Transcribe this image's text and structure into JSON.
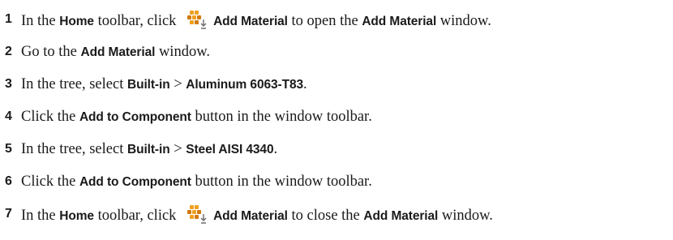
{
  "steps": [
    {
      "number": "1",
      "parts": [
        {
          "t": "In the "
        },
        {
          "t": "Home",
          "b": true
        },
        {
          "t": " toolbar, click "
        },
        {
          "icon": "add-material-icon"
        },
        {
          "t": "Add Material",
          "b": true
        },
        {
          "t": " to open the "
        },
        {
          "t": "Add Material",
          "b": true
        },
        {
          "t": " window."
        }
      ]
    },
    {
      "number": "2",
      "parts": [
        {
          "t": "Go to the "
        },
        {
          "t": "Add Material",
          "b": true
        },
        {
          "t": " window."
        }
      ]
    },
    {
      "number": "3",
      "parts": [
        {
          "t": "In the tree, select "
        },
        {
          "t": "Built-in",
          "b": true
        },
        {
          "t": " > "
        },
        {
          "t": "Aluminum 6063-T83",
          "b": true
        },
        {
          "t": "."
        }
      ]
    },
    {
      "number": "4",
      "parts": [
        {
          "t": "Click the "
        },
        {
          "t": "Add to Component",
          "b": true
        },
        {
          "t": " button in the window toolbar."
        }
      ]
    },
    {
      "number": "5",
      "parts": [
        {
          "t": "In the tree, select "
        },
        {
          "t": "Built-in",
          "b": true
        },
        {
          "t": " > "
        },
        {
          "t": "Steel AISI 4340",
          "b": true
        },
        {
          "t": "."
        }
      ]
    },
    {
      "number": "6",
      "parts": [
        {
          "t": "Click the "
        },
        {
          "t": "Add to Component",
          "b": true
        },
        {
          "t": " button in the window toolbar."
        }
      ]
    },
    {
      "number": "7",
      "parts": [
        {
          "t": "In the "
        },
        {
          "t": "Home",
          "b": true
        },
        {
          "t": " toolbar, click "
        },
        {
          "icon": "add-material-icon"
        },
        {
          "t": "Add Material",
          "b": true
        },
        {
          "t": " to close the "
        },
        {
          "t": "Add Material",
          "b": true
        },
        {
          "t": " window."
        }
      ]
    }
  ],
  "colors": {
    "text": "#1a1a1a",
    "icon_orange": "#f0a020",
    "icon_dark_orange": "#d27a10",
    "icon_arrow": "#6b6b6b"
  }
}
